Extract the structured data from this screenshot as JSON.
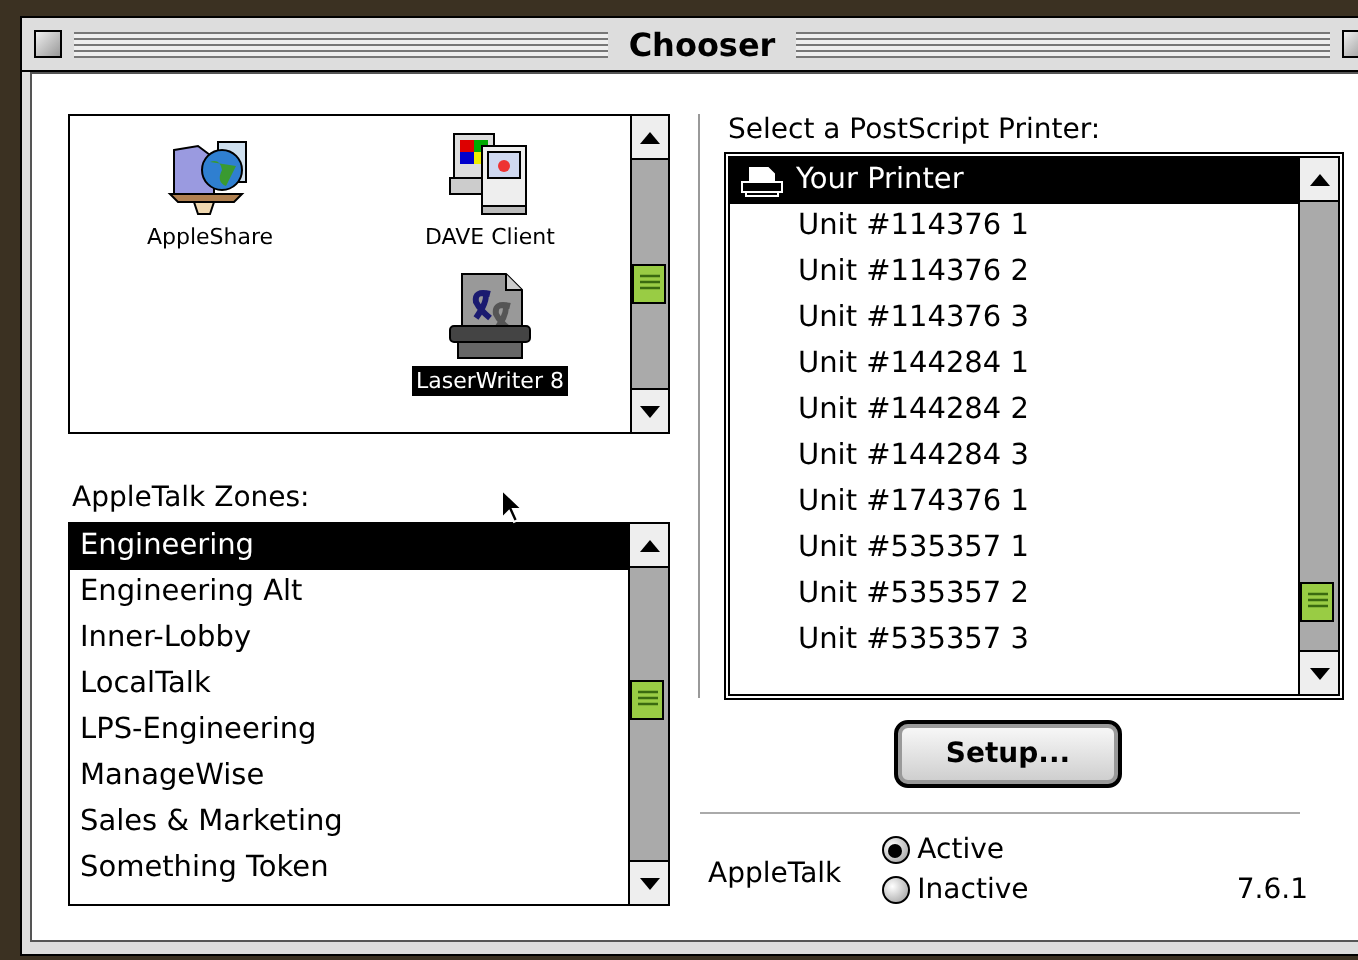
{
  "window": {
    "title": "Chooser"
  },
  "devices": [
    {
      "label": "AppleShare",
      "kind": "appleshare",
      "selected": false
    },
    {
      "label": "DAVE Client",
      "kind": "dave",
      "selected": false
    },
    {
      "label": "LaserWriter 8",
      "kind": "laserwriter",
      "selected": true
    }
  ],
  "zones": {
    "label": "AppleTalk Zones:",
    "items": [
      {
        "label": "Engineering",
        "selected": true
      },
      {
        "label": "Engineering Alt",
        "selected": false
      },
      {
        "label": "Inner-Lobby",
        "selected": false
      },
      {
        "label": "LocalTalk",
        "selected": false
      },
      {
        "label": "LPS-Engineering",
        "selected": false
      },
      {
        "label": "ManageWise",
        "selected": false
      },
      {
        "label": "Sales & Marketing",
        "selected": false
      },
      {
        "label": "Something Token",
        "selected": false
      }
    ]
  },
  "printers": {
    "label": "Select a PostScript Printer:",
    "items": [
      {
        "label": "Your Printer",
        "kind": "printer",
        "selected": true
      },
      {
        "label": "Unit #114376 1",
        "kind": "unit",
        "selected": false
      },
      {
        "label": "Unit #114376 2",
        "kind": "unit",
        "selected": false
      },
      {
        "label": "Unit #114376 3",
        "kind": "unit",
        "selected": false
      },
      {
        "label": "Unit #144284 1",
        "kind": "unit",
        "selected": false
      },
      {
        "label": "Unit #144284 2",
        "kind": "unit",
        "selected": false
      },
      {
        "label": "Unit #144284 3",
        "kind": "unit",
        "selected": false
      },
      {
        "label": "Unit #174376 1",
        "kind": "unit",
        "selected": false
      },
      {
        "label": "Unit #535357 1",
        "kind": "unit",
        "selected": false
      },
      {
        "label": "Unit #535357 2",
        "kind": "unit",
        "selected": false
      },
      {
        "label": "Unit #535357 3",
        "kind": "unit",
        "selected": false
      }
    ]
  },
  "setup_button": "Setup...",
  "appletalk": {
    "label": "AppleTalk",
    "options": [
      {
        "label": "Active",
        "selected": true
      },
      {
        "label": "Inactive",
        "selected": false
      }
    ]
  },
  "version": "7.6.1"
}
